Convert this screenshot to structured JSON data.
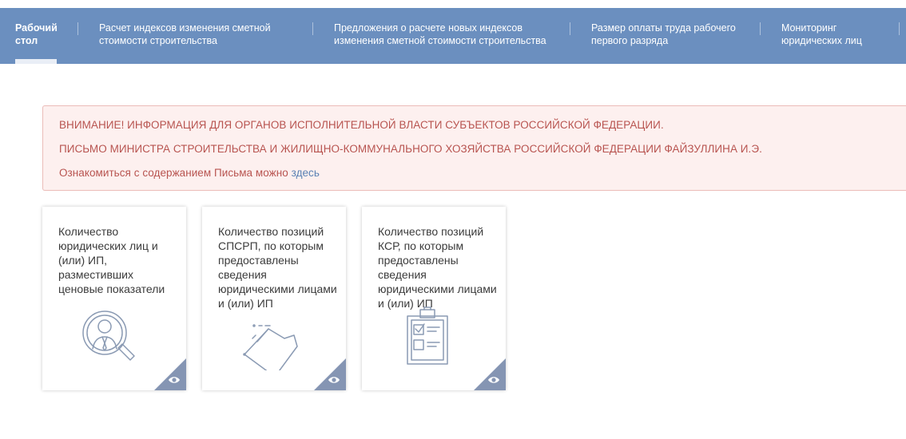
{
  "nav": {
    "items": [
      {
        "label": "Рабочий стол",
        "active": true
      },
      {
        "label": "Расчет индексов изменения сметной стоимости строительства",
        "active": false
      },
      {
        "label": "Предложения о расчете новых индексов изменения сметной стоимости строительства",
        "active": false
      },
      {
        "label": "Размер оплаты труда рабочего первого разряда",
        "active": false
      },
      {
        "label": "Мониторинг юридических лиц",
        "active": false
      }
    ]
  },
  "alert": {
    "line1": "ВНИМАНИЕ! ИНФОРМАЦИЯ ДЛЯ ОРГАНОВ ИСПОЛНИТЕЛЬНОЙ ВЛАСТИ СУБЪЕКТОВ РОССИЙСКОЙ ФЕДЕРАЦИИ.",
    "line2": "ПИСЬМО МИНИСТРА СТРОИТЕЛЬСТВА И ЖИЛИЩНО-КОММУНАЛЬНОГО ХОЗЯЙСТВА РОССИЙСКОЙ ФЕДЕРАЦИИ ФАЙЗУЛЛИНА И.Э.",
    "line3_text": "Ознакомиться с содержанием Письма можно",
    "line3_link": "здесь"
  },
  "cards": [
    {
      "text": "Количество юридических лиц и (или) ИП, разместивших ценовые показатели",
      "icon": "person-search-icon"
    },
    {
      "text": "Количество позиций СПСРП, по которым предоставлены сведения юридическими лицами и (или) ИП",
      "icon": "construction-materials-icon"
    },
    {
      "text": "Количество позиций КСР, по которым предоставлены сведения юридическими лицами и (или) ИП",
      "icon": "checklist-clipboard-icon"
    }
  ],
  "colors": {
    "nav_bg": "#6b8fbf",
    "alert_text": "#b85450",
    "alert_bg": "#fdf0ef",
    "link": "#5b82b4",
    "icon_stroke": "#8a9ab3",
    "corner_bg": "#8595b3"
  }
}
